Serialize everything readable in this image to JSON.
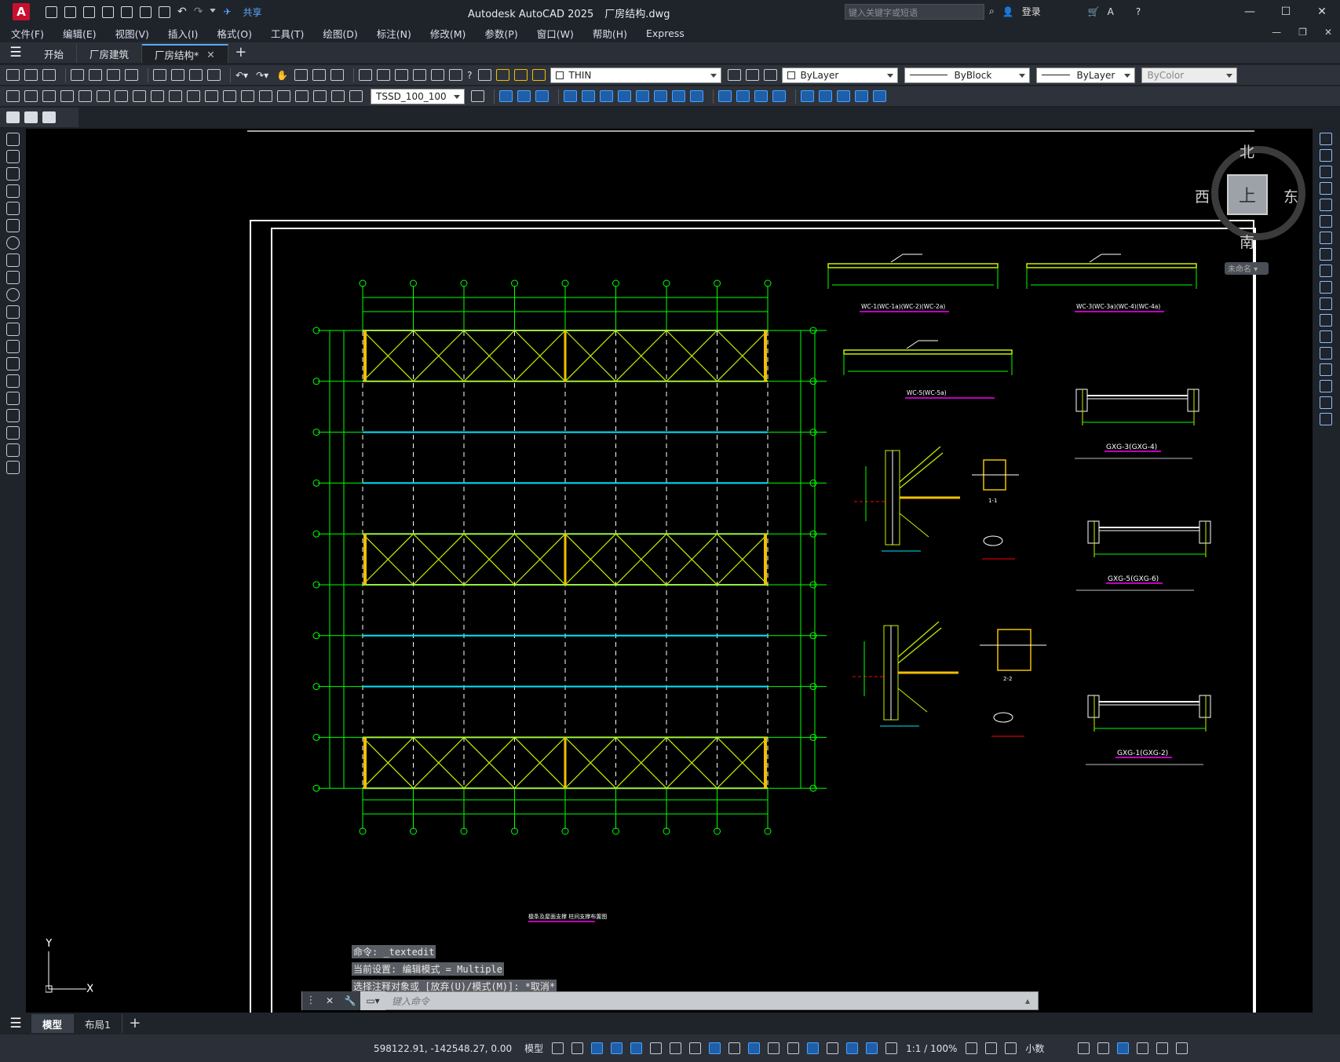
{
  "app": {
    "title": "Autodesk AutoCAD 2025",
    "filename": "厂房结构.dwg",
    "share_label": "共享",
    "search_placeholder": "键入关键字或短语",
    "signin_label": "登录"
  },
  "menu": [
    "文件(F)",
    "编辑(E)",
    "视图(V)",
    "插入(I)",
    "格式(O)",
    "工具(T)",
    "绘图(D)",
    "标注(N)",
    "修改(M)",
    "参数(P)",
    "窗口(W)",
    "帮助(H)",
    "Express"
  ],
  "file_tabs": [
    {
      "label": "开始",
      "active": false
    },
    {
      "label": "厂房建筑",
      "active": false
    },
    {
      "label": "厂房结构*",
      "active": true
    }
  ],
  "toolbar": {
    "layer_name": "THIN",
    "color": "ByLayer",
    "linetype": "ByBlock",
    "lineweight": "ByLayer",
    "plotstyle": "ByColor",
    "dim_style": "TSSD_100_100"
  },
  "viewcube": {
    "north": "北",
    "south": "南",
    "east": "东",
    "west": "西",
    "top": "上",
    "wcs": "未命名"
  },
  "command_history": [
    "命令: _textedit",
    "当前设置: 编辑模式 = Multiple",
    "选择注释对象或 [放弃(U)/模式(M)]: *取消*"
  ],
  "command_placeholder": "键入命令",
  "layout_tabs": [
    {
      "label": "模型",
      "active": true
    },
    {
      "label": "布局1",
      "active": false
    }
  ],
  "status": {
    "coordinates": "598122.91, -142548.27, 0.00",
    "space": "模型",
    "scale": "1:1 / 100%",
    "units": "小数"
  },
  "drawing": {
    "plan_title": "檩条及屋面支撑 柱间支撑布置图",
    "detail_labels": [
      "WC-1(WC-1a)(WC-2)(WC-2a)",
      "WC-3(WC-3a)(WC-4)(WC-4a)",
      "WC-5(WC-5a)",
      "GXG-3(GXG-4)",
      "GXG-5(GXG-6)",
      "GXG-1(GXG-2)",
      "1-1",
      "2-2"
    ],
    "colors": {
      "grid": "#00ff00",
      "purlin": "#00e5ff",
      "brace": "#c8f000",
      "frame": "#ffffff",
      "title_underline": "#ff00ff",
      "dim": "#ff0000"
    }
  }
}
